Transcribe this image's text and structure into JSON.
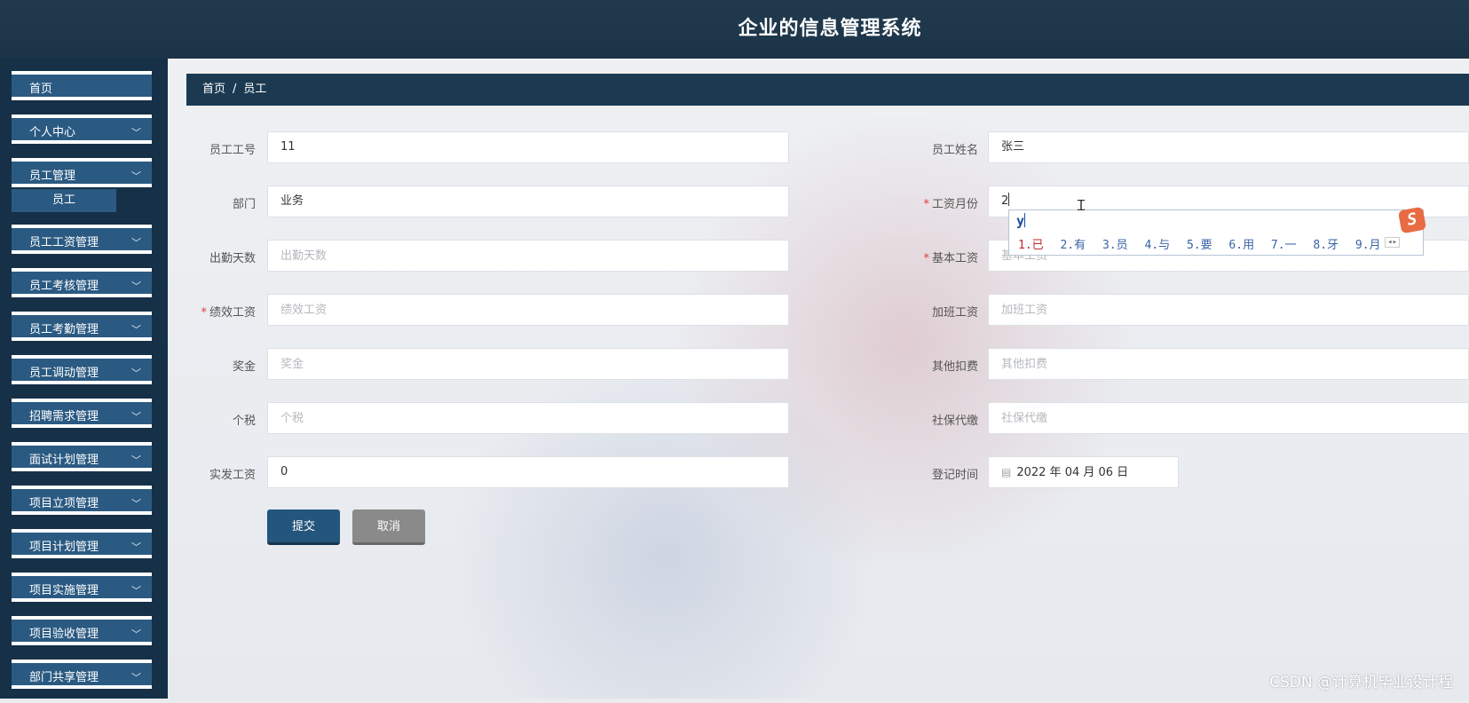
{
  "header": {
    "title": "企业的信息管理系统"
  },
  "sidebar": {
    "items": [
      {
        "label": "首页",
        "chevron": false
      },
      {
        "label": "个人中心",
        "chevron": true
      },
      {
        "label": "员工管理",
        "chevron": true,
        "sub": [
          "员工"
        ]
      },
      {
        "label": "员工工资管理",
        "chevron": true
      },
      {
        "label": "员工考核管理",
        "chevron": true
      },
      {
        "label": "员工考勤管理",
        "chevron": true
      },
      {
        "label": "员工调动管理",
        "chevron": true
      },
      {
        "label": "招聘需求管理",
        "chevron": true
      },
      {
        "label": "面试计划管理",
        "chevron": true
      },
      {
        "label": "项目立项管理",
        "chevron": true
      },
      {
        "label": "项目计划管理",
        "chevron": true
      },
      {
        "label": "项目实施管理",
        "chevron": true
      },
      {
        "label": "项目验收管理",
        "chevron": true
      },
      {
        "label": "部门共享管理",
        "chevron": true
      }
    ]
  },
  "breadcrumb": {
    "home": "首页",
    "separator": "/",
    "current": "员工"
  },
  "form": {
    "employee_no": {
      "label": "员工工号",
      "value": "11"
    },
    "employee_name": {
      "label": "员工姓名",
      "value": "张三"
    },
    "department": {
      "label": "部门",
      "value": "业务"
    },
    "salary_month": {
      "label": "工资月份",
      "value": "2",
      "required": true
    },
    "attendance_days": {
      "label": "出勤天数",
      "placeholder": "出勤天数"
    },
    "base_salary": {
      "label": "基本工资",
      "placeholder": "基本工资",
      "required": true
    },
    "performance_salary": {
      "label": "绩效工资",
      "placeholder": "绩效工资",
      "required": true
    },
    "overtime_salary": {
      "label": "加班工资",
      "placeholder": "加班工资"
    },
    "bonus": {
      "label": "奖金",
      "placeholder": "奖金"
    },
    "other_deductions": {
      "label": "其他扣费",
      "placeholder": "其他扣费"
    },
    "income_tax": {
      "label": "个税",
      "placeholder": "个税"
    },
    "social_insurance": {
      "label": "社保代缴",
      "placeholder": "社保代缴"
    },
    "net_salary": {
      "label": "实发工资",
      "value": "0"
    },
    "register_time": {
      "label": "登记时间",
      "value": "2022 年 04 月 06 日"
    },
    "required_mark": "*"
  },
  "buttons": {
    "submit": "提交",
    "cancel": "取消"
  },
  "ime": {
    "composition": "y",
    "candidates": [
      "1.已",
      "2.有",
      "3.员",
      "4.与",
      "5.要",
      "6.用",
      "7.一",
      "8.牙",
      "9.月"
    ],
    "arrows": "◂▸",
    "logo": "S"
  },
  "watermark": "CSDN @计算机毕业设计程",
  "colors": {
    "header": "#1c3447",
    "sidebar_item": "#2a5a82",
    "primary": "#24557c",
    "required": "#e4393c"
  }
}
